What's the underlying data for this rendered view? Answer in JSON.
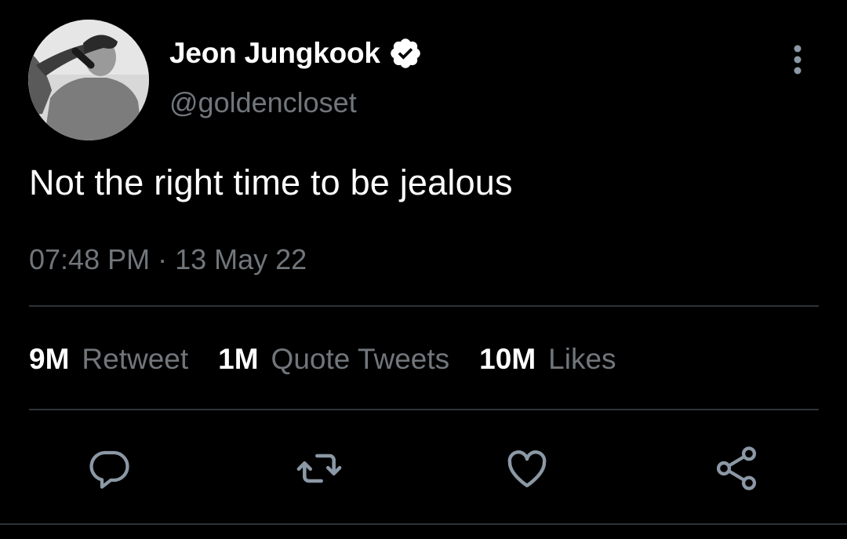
{
  "tweet": {
    "author": {
      "display_name": "Jeon Jungkook",
      "handle": "@goldencloset",
      "verified_icon": "verified-badge-icon",
      "avatar": "profile-photo"
    },
    "text": "Not the right time to be jealous",
    "time": "07:48 PM",
    "separator": "·",
    "date": "13 May 22",
    "stats": [
      {
        "count": "9M",
        "label": "Retweet"
      },
      {
        "count": "1M",
        "label": "Quote Tweets"
      },
      {
        "count": "10M",
        "label": "Likes"
      }
    ],
    "actions": [
      {
        "name": "reply",
        "icon": "reply-icon"
      },
      {
        "name": "retweet",
        "icon": "retweet-icon"
      },
      {
        "name": "like",
        "icon": "heart-icon"
      },
      {
        "name": "share",
        "icon": "share-icon"
      }
    ],
    "menu_icon": "more-options-icon"
  },
  "colors": {
    "background": "#000000",
    "primary_text": "#ffffff",
    "secondary_text": "#71767b",
    "divider": "#2f3336",
    "icon": "#8b98a5"
  }
}
